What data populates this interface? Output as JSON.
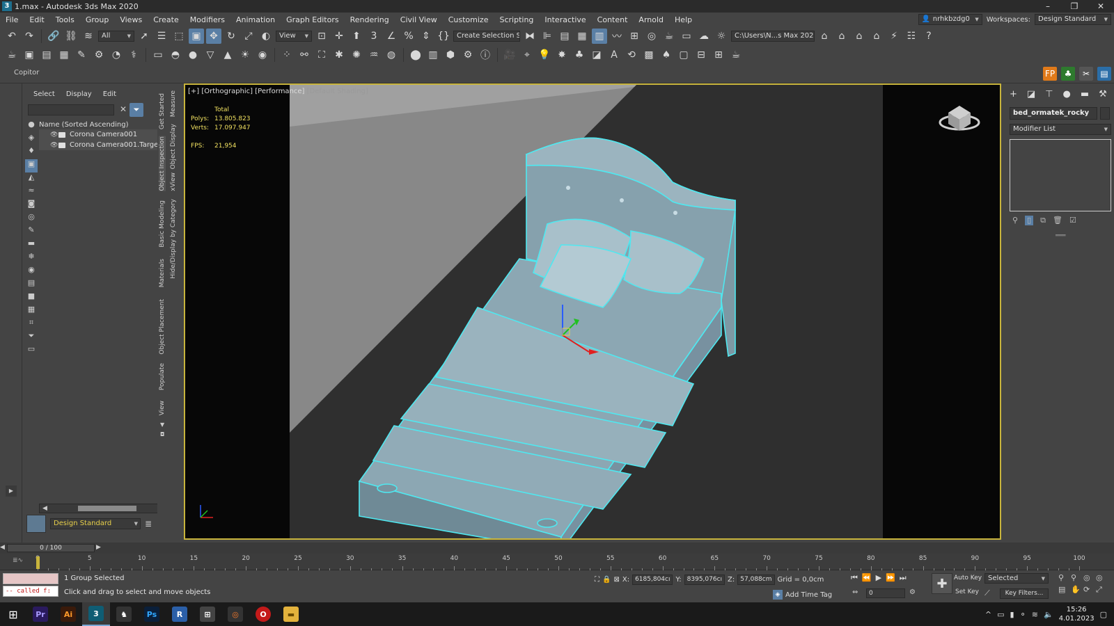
{
  "window": {
    "title": "1.max - Autodesk 3ds Max 2020",
    "app_icon": "3",
    "controls": [
      "–",
      "❐",
      "✕"
    ]
  },
  "menu": {
    "items": [
      "File",
      "Edit",
      "Tools",
      "Group",
      "Views",
      "Create",
      "Modifiers",
      "Animation",
      "Graph Editors",
      "Rendering",
      "Civil View",
      "Customize",
      "Scripting",
      "Interactive",
      "Content",
      "Arnold",
      "Help"
    ],
    "user": "nrhkbzdg0",
    "workspaces_label": "Workspaces:",
    "workspace": "Design Standard"
  },
  "toolbar1": {
    "filter": "All",
    "ref_coord": "View",
    "selection_set": "Create Selection Se",
    "project_path": "C:\\Users\\N...s Max 2020"
  },
  "ribbon": {
    "label": "Copitor"
  },
  "explorer": {
    "tabs": [
      "Select",
      "Display",
      "Edit"
    ],
    "column_header": "Name (Sorted Ascending)",
    "rows": [
      "Corona Camera001",
      "Corona Camera001.Target"
    ],
    "layer": "Design Standard"
  },
  "side_tabs": {
    "col1": [
      "Get Started",
      "Object Inspection",
      "Basic Modeling",
      "Materials",
      "Object Placement",
      "Populate",
      "View"
    ],
    "col2": [
      "Measure",
      "Object Display",
      "xView",
      "Hide/Display by Category"
    ]
  },
  "viewport": {
    "label_plus": "[+]",
    "label_view": "[Orthographic]",
    "label_perf": "[Performance]",
    "label_shading": "[Default Shading]",
    "stats": {
      "total_label": "Total",
      "polys_label": "Polys:",
      "polys": "13.805.823",
      "verts_label": "Verts:",
      "verts": "17.097.947",
      "fps_label": "FPS:",
      "fps": "21,954"
    }
  },
  "command_panel": {
    "object_name": "bed_ormatek_rocky",
    "modifier_list": "Modifier List"
  },
  "timeline": {
    "slider": "0 / 100",
    "ticks": [
      "0",
      "5",
      "10",
      "15",
      "20",
      "25",
      "30",
      "35",
      "40",
      "45",
      "50",
      "55",
      "60",
      "65",
      "70",
      "75",
      "80",
      "85",
      "90",
      "95",
      "100"
    ]
  },
  "status": {
    "script_line": "-- called f:",
    "selection": "1 Group Selected",
    "prompt": "Click and drag to select and move objects",
    "x_label": "X:",
    "x": "6185,804cı",
    "y_label": "Y:",
    "y": "8395,076cı",
    "z_label": "Z:",
    "z": "57,088cm",
    "grid": "Grid = 0,0cm",
    "add_time_tag": "Add Time Tag",
    "frame": "0",
    "auto_key": "Auto Key",
    "set_key": "Set Key",
    "key_mode": "Selected",
    "key_filters": "Key Filters..."
  },
  "taskbar": {
    "apps": [
      {
        "name": "premiere",
        "label": "Pr",
        "color": "#2a1a5e"
      },
      {
        "name": "illustrator",
        "label": "Ai",
        "color": "#3a1a0a"
      },
      {
        "name": "3dsmax",
        "label": "3",
        "color": "#0f5d74"
      },
      {
        "name": "rhino",
        "label": "R",
        "color": "#333"
      },
      {
        "name": "photoshop",
        "label": "Ps",
        "color": "#0a1f3a"
      },
      {
        "name": "revit",
        "label": "R",
        "color": "#2b5fa8"
      },
      {
        "name": "calculator",
        "label": "⊞",
        "color": "#444"
      },
      {
        "name": "blender",
        "label": "◎",
        "color": "#333"
      },
      {
        "name": "opera",
        "label": "O",
        "color": "#c41a1a"
      },
      {
        "name": "explorer",
        "label": "▬",
        "color": "#e3b23c"
      }
    ],
    "time": "15:26",
    "date": "4.01.2023"
  },
  "colors": {
    "bg": "#444444",
    "viewport_border": "#c8b43c",
    "selection_outline": "#4fe8f0",
    "bed_fill": "#8aa4b0",
    "stats_text": "#f0e060",
    "accent": "#5a7fa5"
  }
}
